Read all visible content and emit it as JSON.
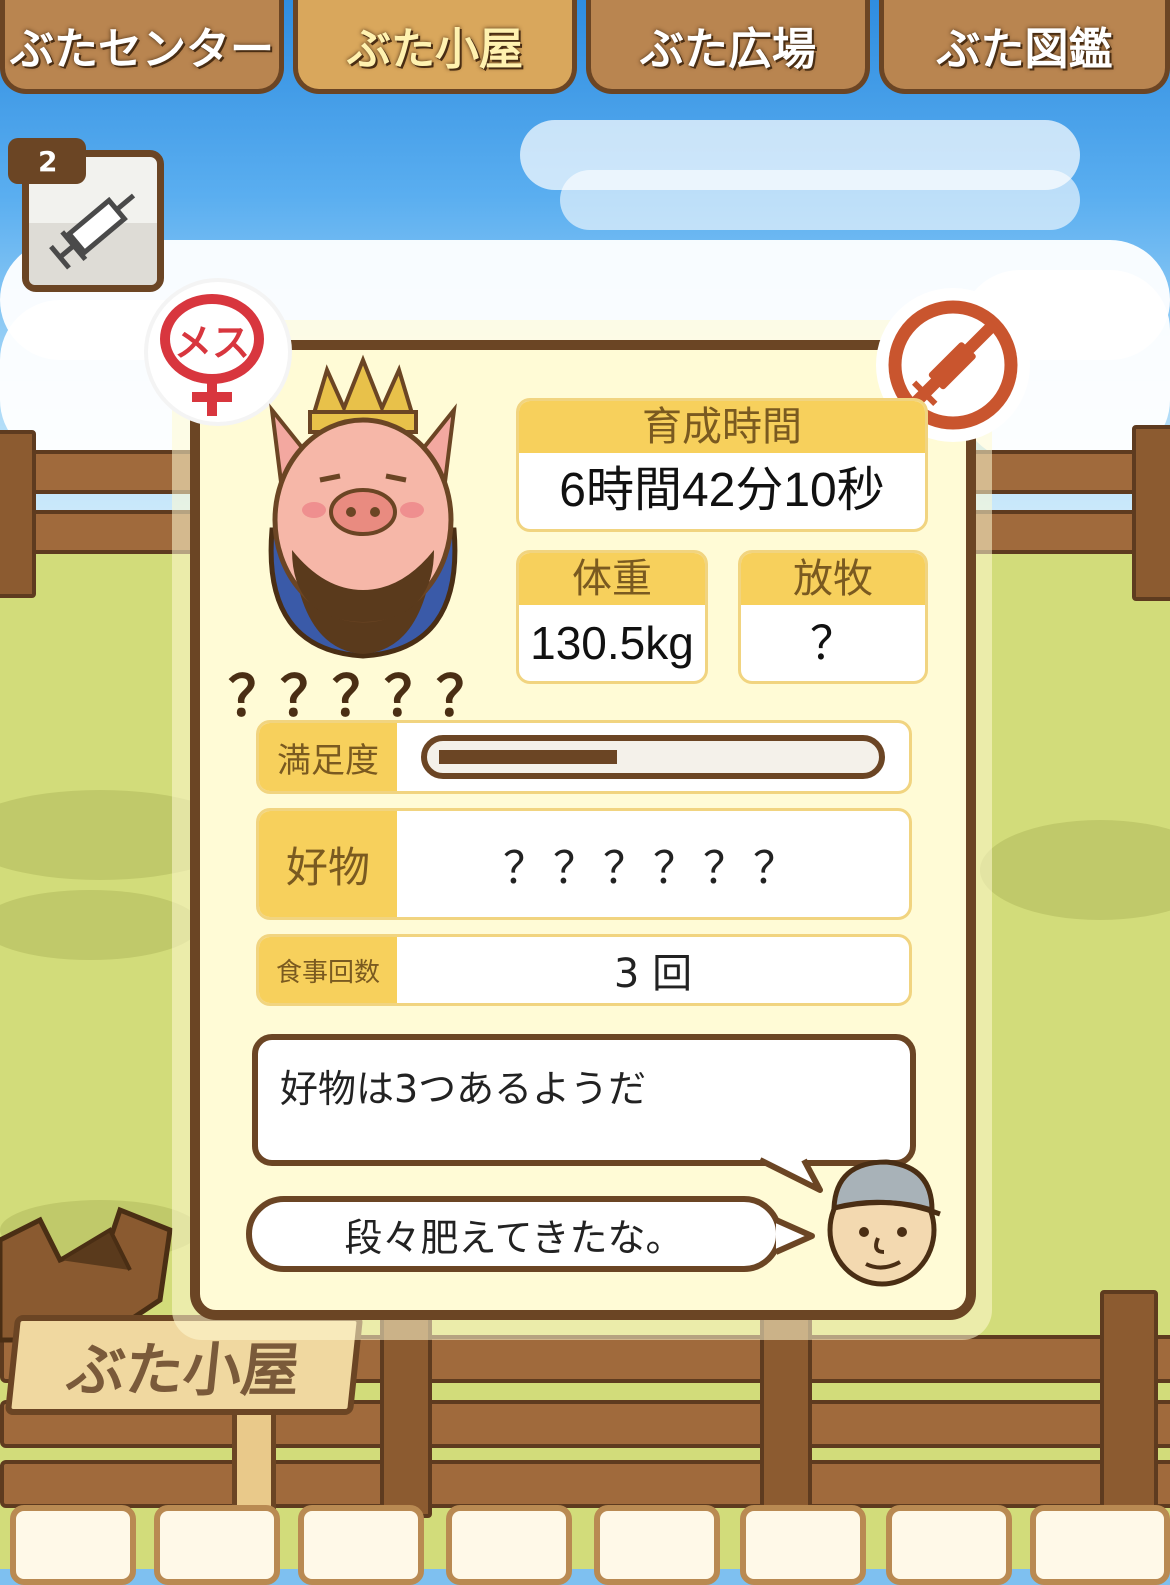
{
  "tabs": [
    {
      "label": "ぶたセンター",
      "active": false
    },
    {
      "label": "ぶた小屋",
      "active": true
    },
    {
      "label": "ぶた広場",
      "active": false
    },
    {
      "label": "ぶた図鑑",
      "active": false
    }
  ],
  "item": {
    "count": "2",
    "icon": "syringe-icon"
  },
  "pig": {
    "sex_badge": "メス",
    "name": "？？？？？",
    "growth_time_label": "育成時間",
    "growth_time": "6時間42分10秒",
    "weight_label": "体重",
    "weight": "130.5kg",
    "grazing_label": "放牧",
    "grazing": "？",
    "satisfaction_label": "満足度",
    "satisfaction": 0.42,
    "favorite_label": "好物",
    "favorite": "？？？？？？",
    "meals_label": "食事回数",
    "meals": "3 回"
  },
  "messages": {
    "hint": "好物は3つあるようだ",
    "farmer": "段々肥えてきたな。"
  },
  "sign": "ぶた小屋",
  "colors": {
    "wood": "#6b4524",
    "panel": "#fffbd6",
    "header": "#f7d05c",
    "female": "#d8363e"
  }
}
